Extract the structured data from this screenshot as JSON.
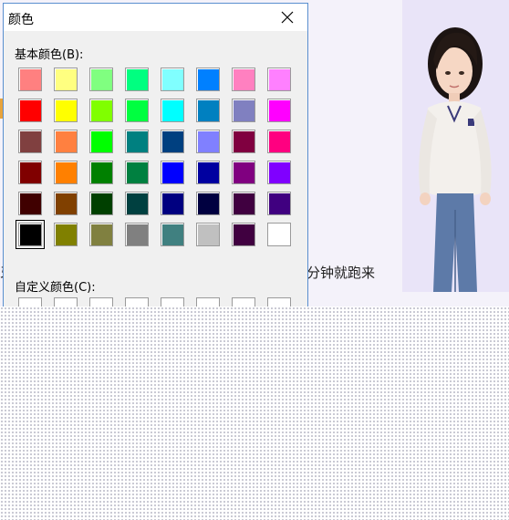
{
  "dialog": {
    "title": "颜色",
    "basic_colors_label": "基本颜色(B):",
    "custom_colors_label": "自定义颜色(C):",
    "close_icon": "close-icon",
    "basic_colors": [
      [
        "#ff8080",
        "#ffff80",
        "#80ff80",
        "#00ff80",
        "#80ffff",
        "#0080ff",
        "#ff80c0",
        "#ff80ff"
      ],
      [
        "#ff0000",
        "#ffff00",
        "#80ff00",
        "#00ff40",
        "#00ffff",
        "#0080c0",
        "#8080c0",
        "#ff00ff"
      ],
      [
        "#804040",
        "#ff8040",
        "#00ff00",
        "#008080",
        "#004080",
        "#8080ff",
        "#800040",
        "#ff0080"
      ],
      [
        "#800000",
        "#ff8000",
        "#008000",
        "#008040",
        "#0000ff",
        "#0000a0",
        "#800080",
        "#8000ff"
      ],
      [
        "#400000",
        "#804000",
        "#004000",
        "#004040",
        "#000080",
        "#000040",
        "#400040",
        "#400080"
      ],
      [
        "#000000",
        "#808000",
        "#808040",
        "#808080",
        "#408080",
        "#c0c0c0",
        "#400040",
        "#ffffff"
      ]
    ],
    "selected_color": "#000000",
    "custom_colors": [
      "#ffffff",
      "#ffffff",
      "#ffffff",
      "#ffffff",
      "#ffffff",
      "#ffffff",
      "#ffffff",
      "#ffffff"
    ]
  },
  "background": {
    "text_right": "分钟就跑来",
    "text_left": "牙"
  }
}
